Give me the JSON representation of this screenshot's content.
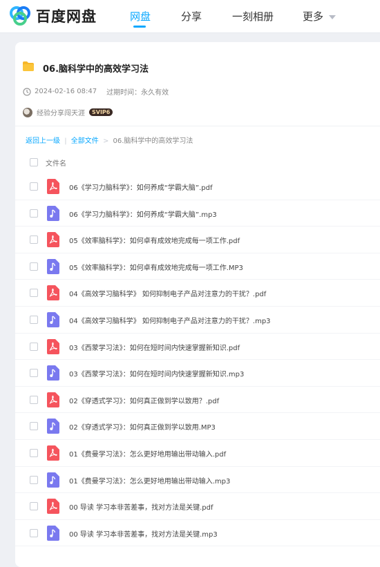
{
  "brand": {
    "name": "百度网盘"
  },
  "nav": {
    "items": [
      {
        "label": "网盘",
        "active": true
      },
      {
        "label": "分享",
        "active": false
      },
      {
        "label": "一刻相册",
        "active": false
      },
      {
        "label": "更多",
        "active": false
      }
    ]
  },
  "share": {
    "title": "06.脑科学中的高效学习法",
    "created": "2024-02-16 08:47",
    "expire_label": "过期时间：永久有效",
    "sharer": "经验分享闯天涯",
    "badge": "SVIP6"
  },
  "breadcrumb": {
    "back": "返回上一级",
    "all": "全部文件",
    "current": "06.脑科学中的高效学习法"
  },
  "list": {
    "column_header": "文件名",
    "files": [
      {
        "name": "06《学习力脑科学》：如何养成“学霸大脑”.pdf",
        "type": "pdf"
      },
      {
        "name": "06《学习力脑科学》：如何养成“学霸大脑”.mp3",
        "type": "audio"
      },
      {
        "name": "05《效率脑科学》：如何卓有成效地完成每一项工作.pdf",
        "type": "pdf"
      },
      {
        "name": "05《效率脑科学》：如何卓有成效地完成每一项工作.MP3",
        "type": "audio"
      },
      {
        "name": "04《高效学习脑科学》 如何抑制电子产品对注意力的干扰？.pdf",
        "type": "pdf"
      },
      {
        "name": "04《高效学习脑科学》 如何抑制电子产品对注意力的干扰？.mp3",
        "type": "audio"
      },
      {
        "name": "03《西蒙学习法》：如何在短时间内快速掌握新知识.pdf",
        "type": "pdf"
      },
      {
        "name": "03《西蒙学习法》：如何在短时间内快速掌握新知识.mp3",
        "type": "audio"
      },
      {
        "name": "02《穿透式学习》：如何真正做到学以致用？.pdf",
        "type": "pdf"
      },
      {
        "name": "02《穿透式学习》：如何真正做到学以致用.MP3",
        "type": "audio"
      },
      {
        "name": "01《费曼学习法》：怎么更好地用输出带动输入.pdf",
        "type": "pdf"
      },
      {
        "name": "01《费曼学习法》：怎么更好地用输出带动输入.mp3",
        "type": "audio"
      },
      {
        "name": "00 导读 学习本非苦差事，找对方法是关键.pdf",
        "type": "pdf"
      },
      {
        "name": "00 导读 学习本非苦差事，找对方法是关键.mp3",
        "type": "audio"
      }
    ]
  },
  "colors": {
    "accent": "#06a7ff",
    "pdf": "#f5545d",
    "audio": "#7a79ef",
    "folder": "#f6b72a"
  }
}
